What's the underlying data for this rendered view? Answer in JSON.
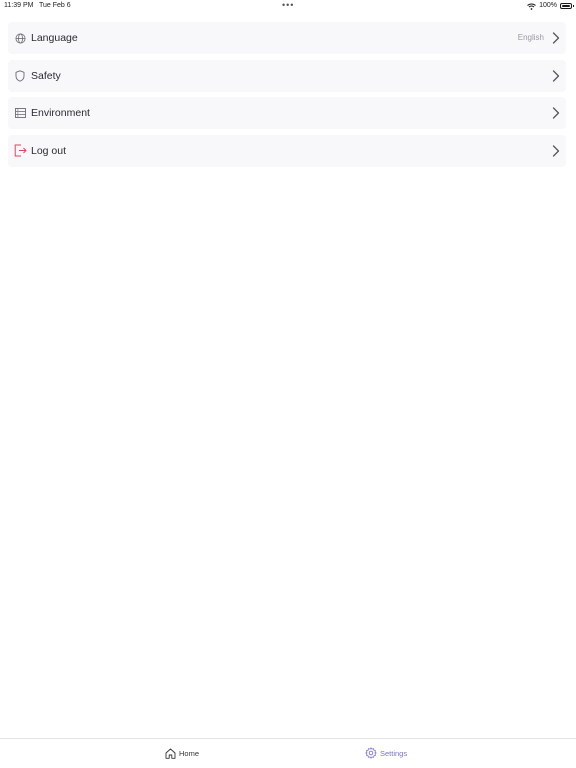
{
  "status_bar": {
    "time": "11:39 PM",
    "date": "Tue Feb 6",
    "battery": "100%",
    "icons": [
      "wifi-icon",
      "battery-icon"
    ]
  },
  "settings": {
    "items": [
      {
        "label": "Language",
        "value": "English",
        "icon": "globe-icon"
      },
      {
        "label": "Safety",
        "icon": "shield-icon"
      },
      {
        "label": "Environment",
        "icon": "server-icon"
      },
      {
        "label": "Log out",
        "icon": "logout-icon",
        "icon_color": "#e0455a"
      }
    ]
  },
  "tab_bar": {
    "tabs": [
      {
        "label": "Home",
        "icon": "home-icon",
        "active": false
      },
      {
        "label": "Settings",
        "icon": "gear-icon",
        "active": true
      }
    ],
    "active_color": "#7a75c9"
  }
}
